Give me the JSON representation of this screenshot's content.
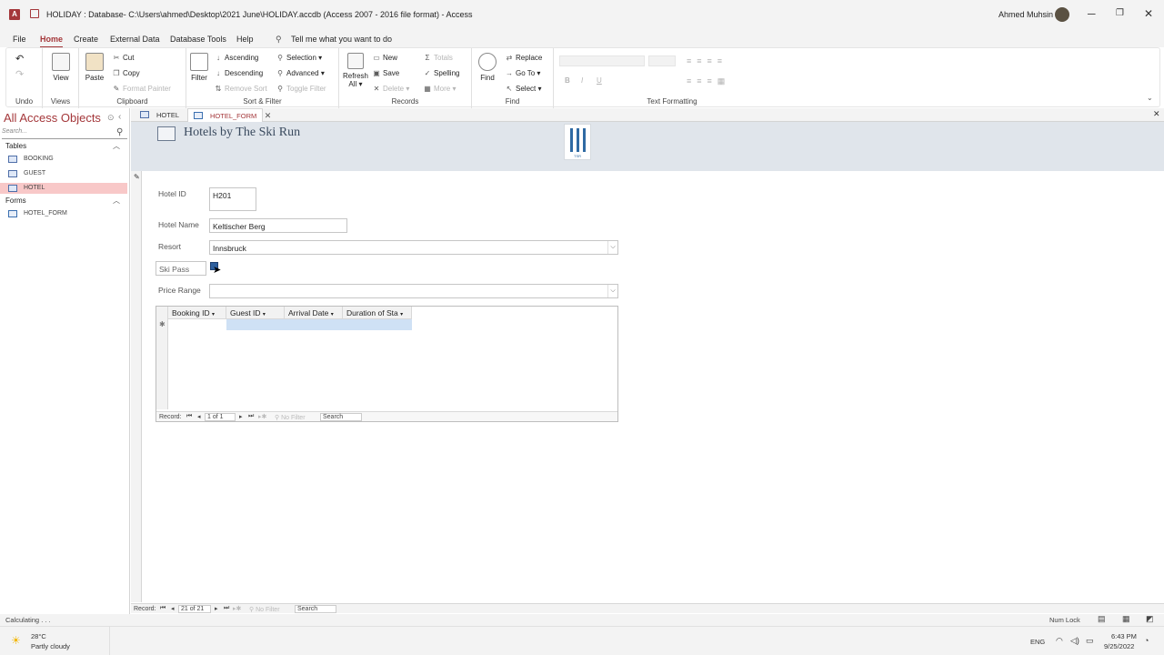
{
  "titlebar": {
    "app_icon": "A",
    "title": "HOLIDAY : Database- C:\\Users\\ahmed\\Desktop\\2021 June\\HOLIDAY.accdb (Access 2007 - 2016 file format)  -  Access",
    "user": "Ahmed Muhsin"
  },
  "menu": {
    "file": "File",
    "home": "Home",
    "create": "Create",
    "external": "External Data",
    "dbtools": "Database Tools",
    "help": "Help",
    "tellme": "Tell me what you want to do"
  },
  "ribbon": {
    "undo": {
      "label": "Undo"
    },
    "views": {
      "view": "View",
      "label": "Views"
    },
    "clipboard": {
      "paste": "Paste",
      "cut": "Cut",
      "copy": "Copy",
      "format_painter": "Format Painter",
      "label": "Clipboard"
    },
    "sortfilter": {
      "filter": "Filter",
      "ascending": "Ascending",
      "descending": "Descending",
      "remove_sort": "Remove Sort",
      "selection": "Selection",
      "advanced": "Advanced",
      "toggle_filter": "Toggle Filter",
      "label": "Sort & Filter"
    },
    "records": {
      "refresh": "Refresh",
      "refresh2": "All",
      "new": "New",
      "save": "Save",
      "delete": "Delete",
      "totals": "Totals",
      "spelling": "Spelling",
      "more": "More",
      "label": "Records"
    },
    "find": {
      "find": "Find",
      "replace": "Replace",
      "goto": "Go To",
      "select": "Select",
      "label": "Find"
    },
    "textfmt": {
      "label": "Text Formatting",
      "bold": "B",
      "italic": "I",
      "underline": "U"
    }
  },
  "nav": {
    "header": "All Access Objects",
    "search_placeholder": "Search...",
    "tables_label": "Tables",
    "forms_label": "Forms",
    "tables": [
      "BOOKING",
      "GUEST",
      "HOTEL"
    ],
    "forms": [
      "HOTEL_FORM"
    ]
  },
  "doctabs": [
    "HOTEL",
    "HOTEL_FORM"
  ],
  "form": {
    "title": "Hotels by The Ski Run",
    "logo_text": "TSR",
    "hotel_id_label": "Hotel ID",
    "hotel_id": "H201",
    "hotel_name_label": "Hotel Name",
    "hotel_name": "Keltischer Berg",
    "resort_label": "Resort",
    "resort": "Innsbruck",
    "skipass_label": "Ski Pass",
    "price_label": "Price Range",
    "price": ""
  },
  "subform": {
    "columns": [
      "Booking ID",
      "Guest ID",
      "Arrival Date",
      "Duration of Sta"
    ],
    "record_label": "Record:",
    "record_pos": "1 of 1",
    "no_filter": "No Filter",
    "search": "Search"
  },
  "main_nav": {
    "record_label": "Record:",
    "record_pos": "21 of 21",
    "no_filter": "No Filter",
    "search": "Search"
  },
  "status": {
    "left": "Calculating . . .",
    "numlock": "Num Lock"
  },
  "taskbar": {
    "temp": "28°C",
    "weather": "Partly cloudy",
    "lang": "ENG",
    "time": "6:43 PM",
    "date": "9/25/2022"
  }
}
